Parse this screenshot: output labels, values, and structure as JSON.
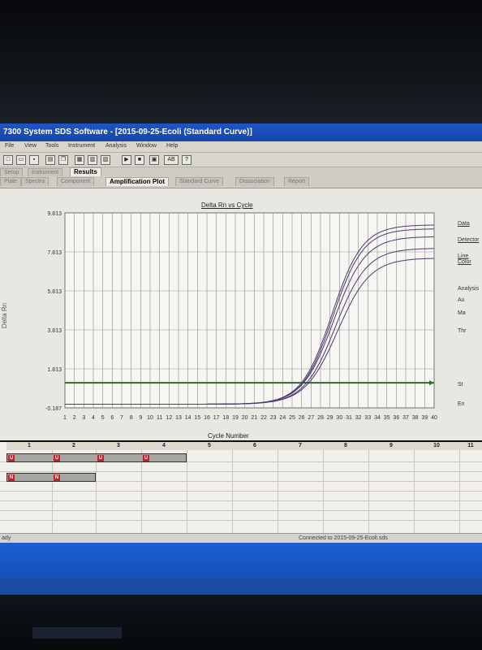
{
  "window": {
    "title": "7300 System SDS Software - [2015-09-25-Ecoli (Standard Curve)]"
  },
  "menu": [
    "File",
    "View",
    "Tools",
    "Instrument",
    "Analysis",
    "Window",
    "Help"
  ],
  "toolbar": {
    "icons": [
      "new-icon",
      "open-icon",
      "save-icon",
      "print-icon",
      "copy-icon",
      "report-icon",
      "table-icon",
      "run-icon",
      "stop-icon",
      "analyze-icon",
      "help-icon"
    ]
  },
  "tabs_top": [
    "Setup",
    "Instrument",
    "Results"
  ],
  "tabs_sub": [
    "Plate",
    "Spectra",
    "Component",
    "Amplification Plot",
    "Standard Curve",
    "Dissociation",
    "Report"
  ],
  "plot": {
    "title": "Delta Rn vs Cycle",
    "ylabel": "Delta Rn",
    "xlabel": "Cycle Number"
  },
  "right_panel": [
    "Data",
    "Detector",
    "Line Color",
    "Analysis",
    "Au",
    "Ma",
    "Thr",
    "St",
    "En"
  ],
  "wells": {
    "columns": [
      "1",
      "2",
      "3",
      "4",
      "5",
      "6",
      "7",
      "8",
      "9",
      "10",
      "11"
    ],
    "row_a_badges": [
      "U",
      "U",
      "U",
      "U"
    ],
    "row_b_badges": [
      "N",
      "N"
    ]
  },
  "status": {
    "left": "ady",
    "right": "Connected to 2015-09-25-Ecoli.sds"
  },
  "colors": {
    "threshold": "#2e6b2e",
    "curves": "#4a3b6e",
    "titlebar": "#1f55c4"
  },
  "chart_data": {
    "type": "line",
    "title": "Delta Rn vs Cycle",
    "xlabel": "Cycle Number",
    "ylabel": "Delta Rn",
    "x": [
      1,
      2,
      3,
      4,
      5,
      6,
      7,
      8,
      9,
      10,
      11,
      12,
      13,
      14,
      15,
      16,
      17,
      18,
      19,
      20,
      21,
      22,
      23,
      24,
      25,
      26,
      27,
      28,
      29,
      30,
      31,
      32,
      33,
      34,
      35,
      36,
      37,
      38,
      39,
      40
    ],
    "xlim": [
      1,
      40
    ],
    "ylim": [
      -0.187,
      9.813
    ],
    "yticks": [
      -0.187,
      1.813,
      3.813,
      5.813,
      7.813,
      9.813
    ],
    "yticklabels": [
      "-0.187",
      "1.813",
      "3.813",
      "5.813",
      "7.813",
      "9.813"
    ],
    "grid": true,
    "threshold": 1.1,
    "series_params": [
      {
        "max": 9.2,
        "mid": 29.2,
        "k": 0.62
      },
      {
        "max": 9.0,
        "mid": 29.3,
        "k": 0.62
      },
      {
        "max": 8.6,
        "mid": 29.4,
        "k": 0.6
      },
      {
        "max": 8.0,
        "mid": 29.6,
        "k": 0.6
      },
      {
        "max": 7.5,
        "mid": 29.8,
        "k": 0.58
      }
    ]
  }
}
